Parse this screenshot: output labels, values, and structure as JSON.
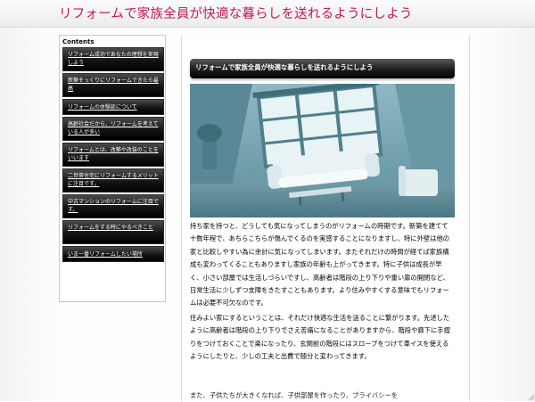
{
  "header": {
    "title": "リフォームで家族全員が快適な暮らしを送れるようにしよう"
  },
  "sidebar": {
    "heading": "Contents",
    "items": [
      "リフォーム成功であなたの理想を実現しよう",
      "新築そっくりにリフォームできたら最高",
      "リフォームの体験談について",
      "高齢社会だから、リフォームを考えている人が多い",
      "リフォームとは、改築や改装のことをいいます",
      "二世帯住宅にリフォームするメリットに注目です。",
      "中古マンションのリフォームに注目です。",
      "リフォームをする時にやるべきこと",
      "いま一番リフォームしたい場所"
    ]
  },
  "article": {
    "title": "リフォームで家族全員が快適な暮らしを送れるようにしよう",
    "image_alt": "living-room-photo",
    "paragraph1": "持ち家を持つと、どうしても気になってしまうのがリフォームの時期です。新築を建てて十数年程で、あちらこちらが傷んでくるのを実感することになりますし、特に外壁は他の家と比較しやすい為に余計に気になってしまいます。またそれだけの時間が経てば家族構成も変わってくることもありますし家族の年齢も上がってきます。特に子供は成長が早く、小さい部屋では生活しづらいですし、高齢者は階段の上り下りや重い扉の開閉など、日常生活に少しずつ支障をきたすこともあります。より住みやすくする意味でもリフォームは必要不可欠なのです。",
    "paragraph2": "住みよい家にするということは、それだけ快適な生活を送ることに繋がります。先述したように高齢者は階段の上り下りでさえ苦痛になることがありますから、階段や廊下に手摺りをつけておくことで楽になったり、玄関前の階段にはスロープをつけて車イスを使えるようにしたりと、少しの工夫と出費で随分と変わってきます。",
    "paragraph3_partial": "また、子供たちが大きくなれば、子供部屋を作ったり、プライバシーを"
  }
}
